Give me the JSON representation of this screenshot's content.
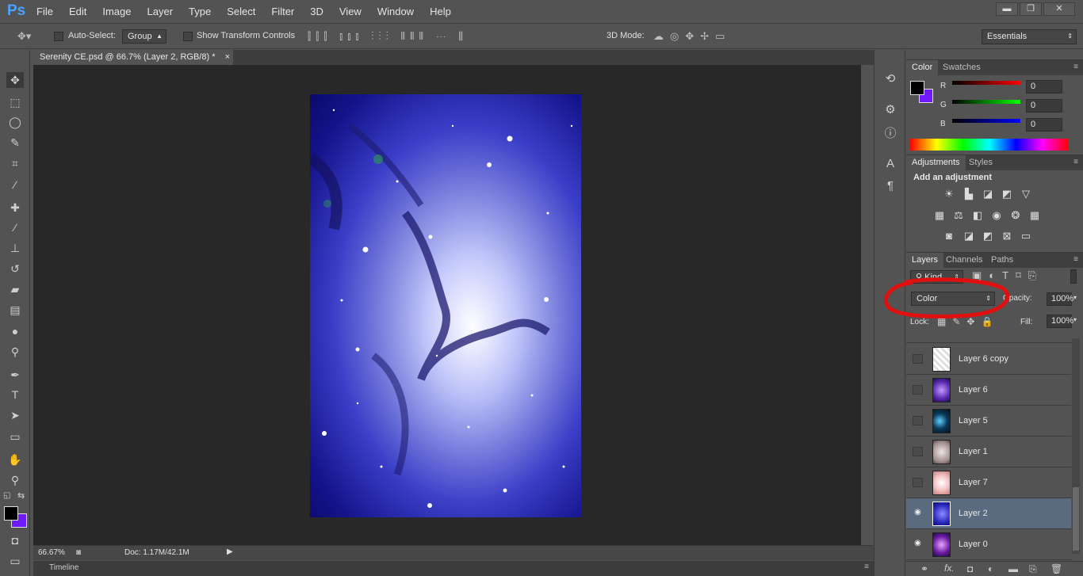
{
  "app": {
    "logo": "Ps"
  },
  "menu": [
    "File",
    "Edit",
    "Image",
    "Layer",
    "Type",
    "Select",
    "Filter",
    "3D",
    "View",
    "Window",
    "Help"
  ],
  "window_controls": {
    "minimize": "▬",
    "restore": "❐",
    "close": "✕"
  },
  "options_bar": {
    "auto_select_label": "Auto-Select:",
    "auto_select_value": "Group",
    "show_transform_label": "Show Transform Controls",
    "mode_3d_label": "3D Mode:",
    "workspace": "Essentials"
  },
  "document": {
    "tab_title": "Serenity CE.psd @ 66.7% (Layer 2, RGB/8) *",
    "close_glyph": "×",
    "zoom": "66.67%",
    "doc_size": "Doc: 1.17M/42.1M"
  },
  "timeline": {
    "label": "Timeline"
  },
  "color_panel": {
    "tabs": [
      "Color",
      "Swatches"
    ],
    "r_label": "R",
    "g_label": "G",
    "b_label": "B",
    "r_value": "0",
    "g_value": "0",
    "b_value": "0",
    "foreground": "#000000",
    "background": "#6d1aff"
  },
  "adjustments_panel": {
    "tabs": [
      "Adjustments",
      "Styles"
    ],
    "heading": "Add an adjustment"
  },
  "layers_panel": {
    "tabs": [
      "Layers",
      "Channels",
      "Paths"
    ],
    "filter_kind": "Kind",
    "blend_mode": "Color",
    "opacity_label": "Opacity:",
    "opacity_value": "100%",
    "lock_label": "Lock:",
    "fill_label": "Fill:",
    "fill_value": "100%",
    "layers": [
      {
        "name": "Layer 6 copy",
        "visible": false,
        "selected": false
      },
      {
        "name": "Layer 6",
        "visible": false,
        "selected": false
      },
      {
        "name": "Layer 5",
        "visible": false,
        "selected": false
      },
      {
        "name": "Layer 1",
        "visible": false,
        "selected": false
      },
      {
        "name": "Layer 7",
        "visible": false,
        "selected": false
      },
      {
        "name": "Layer 2",
        "visible": true,
        "selected": true
      },
      {
        "name": "Layer 0",
        "visible": true,
        "selected": false
      }
    ],
    "footer_icons": [
      "link-icon",
      "fx-icon",
      "mask-icon",
      "adjustment-layer-icon",
      "group-folder-icon",
      "new-layer-icon",
      "trash-icon"
    ]
  },
  "annotation": {
    "color": "#e01010"
  }
}
